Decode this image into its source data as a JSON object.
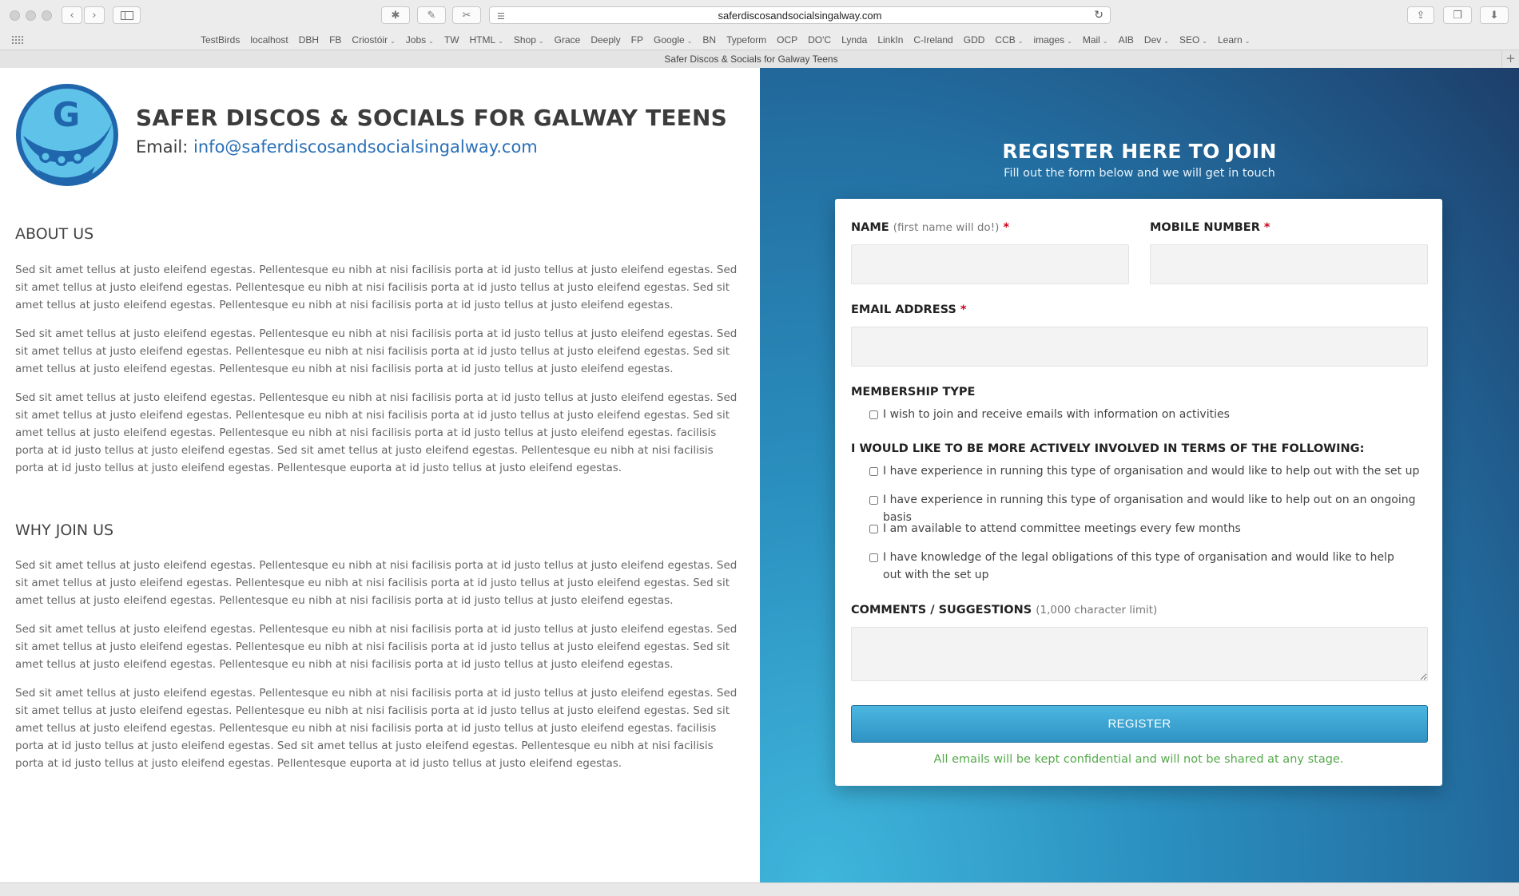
{
  "browser": {
    "url": "saferdiscosandsocialsingalway.com",
    "tab_title": "Safer Discos & Socials for Galway Teens",
    "bookmarks": [
      {
        "label": "TestBirds",
        "menu": false
      },
      {
        "label": "localhost",
        "menu": false
      },
      {
        "label": "DBH",
        "menu": false
      },
      {
        "label": "FB",
        "menu": false
      },
      {
        "label": "Criostóir",
        "menu": true
      },
      {
        "label": "Jobs",
        "menu": true
      },
      {
        "label": "TW",
        "menu": false
      },
      {
        "label": "HTML",
        "menu": true
      },
      {
        "label": "Shop",
        "menu": true
      },
      {
        "label": "Grace",
        "menu": false
      },
      {
        "label": "Deeply",
        "menu": false
      },
      {
        "label": "FP",
        "menu": false
      },
      {
        "label": "Google",
        "menu": true
      },
      {
        "label": "BN",
        "menu": false
      },
      {
        "label": "Typeform",
        "menu": false
      },
      {
        "label": "OCP",
        "menu": false
      },
      {
        "label": "DO'C",
        "menu": false
      },
      {
        "label": "Lynda",
        "menu": false
      },
      {
        "label": "LinkIn",
        "menu": false
      },
      {
        "label": "C-Ireland",
        "menu": false
      },
      {
        "label": "GDD",
        "menu": false
      },
      {
        "label": "CCB",
        "menu": true
      },
      {
        "label": "images",
        "menu": true
      },
      {
        "label": "Mail",
        "menu": true
      },
      {
        "label": "AIB",
        "menu": false
      },
      {
        "label": "Dev",
        "menu": true
      },
      {
        "label": "SEO",
        "menu": true
      },
      {
        "label": "Learn",
        "menu": true
      }
    ]
  },
  "header": {
    "logo_letter": "G",
    "title": "SAFER DISCOS & SOCIALS FOR GALWAY TEENS",
    "email_label": "Email:",
    "email": "info@saferdiscosandsocialsingalway.com"
  },
  "about": {
    "heading": "ABOUT US",
    "paragraphs": [
      "Sed sit amet tellus at justo eleifend egestas. Pellentesque eu nibh at nisi facilisis porta at id justo tellus at justo eleifend egestas. Sed sit amet tellus at justo eleifend egestas. Pellentesque eu nibh at nisi facilisis porta at id justo tellus at justo eleifend egestas. Sed sit amet tellus at justo eleifend egestas. Pellentesque eu nibh at nisi facilisis porta at id justo tellus at justo eleifend egestas.",
      "Sed sit amet tellus at justo eleifend egestas. Pellentesque eu nibh at nisi facilisis porta at id justo tellus at justo eleifend egestas. Sed sit amet tellus at justo eleifend egestas. Pellentesque eu nibh at nisi facilisis porta at id justo tellus at justo eleifend egestas. Sed sit amet tellus at justo eleifend egestas. Pellentesque eu nibh at nisi facilisis porta at id justo tellus at justo eleifend egestas.",
      "Sed sit amet tellus at justo eleifend egestas. Pellentesque eu nibh at nisi facilisis porta at id justo tellus at justo eleifend egestas. Sed sit amet tellus at justo eleifend egestas. Pellentesque eu nibh at nisi facilisis porta at id justo tellus at justo eleifend egestas. Sed sit amet tellus at justo eleifend egestas. Pellentesque eu nibh at nisi facilisis porta at id justo tellus at justo eleifend egestas. facilisis porta at id justo tellus at justo eleifend egestas. Sed sit amet tellus at justo eleifend egestas. Pellentesque eu nibh at nisi facilisis porta at id justo tellus at justo eleifend egestas. Pellentesque euporta at id justo tellus at justo eleifend egestas."
    ]
  },
  "why": {
    "heading": "WHY JOIN US",
    "paragraphs": [
      "Sed sit amet tellus at justo eleifend egestas. Pellentesque eu nibh at nisi facilisis porta at id justo tellus at justo eleifend egestas. Sed sit amet tellus at justo eleifend egestas. Pellentesque eu nibh at nisi facilisis porta at id justo tellus at justo eleifend egestas. Sed sit amet tellus at justo eleifend egestas. Pellentesque eu nibh at nisi facilisis porta at id justo tellus at justo eleifend egestas.",
      "Sed sit amet tellus at justo eleifend egestas. Pellentesque eu nibh at nisi facilisis porta at id justo tellus at justo eleifend egestas. Sed sit amet tellus at justo eleifend egestas. Pellentesque eu nibh at nisi facilisis porta at id justo tellus at justo eleifend egestas. Sed sit amet tellus at justo eleifend egestas. Pellentesque eu nibh at nisi facilisis porta at id justo tellus at justo eleifend egestas.",
      "Sed sit amet tellus at justo eleifend egestas. Pellentesque eu nibh at nisi facilisis porta at id justo tellus at justo eleifend egestas. Sed sit amet tellus at justo eleifend egestas. Pellentesque eu nibh at nisi facilisis porta at id justo tellus at justo eleifend egestas. Sed sit amet tellus at justo eleifend egestas. Pellentesque eu nibh at nisi facilisis porta at id justo tellus at justo eleifend egestas. facilisis porta at id justo tellus at justo eleifend egestas. Sed sit amet tellus at justo eleifend egestas. Pellentesque eu nibh at nisi facilisis porta at id justo tellus at justo eleifend egestas. Pellentesque euporta at id justo tellus at justo eleifend egestas."
    ]
  },
  "register": {
    "title": "REGISTER HERE TO JOIN",
    "subtitle": "Fill out the form below and we will get in touch",
    "name_label": "NAME",
    "name_hint": "(first name will do!)",
    "mobile_label": "MOBILE NUMBER",
    "email_label": "EMAIL ADDRESS",
    "required_mark": "*",
    "name_value": "",
    "mobile_value": "",
    "email_value": "",
    "membership_heading": "MEMBERSHIP TYPE",
    "membership_option": "I wish to join and receive emails with information on activities",
    "involved_heading": "I WOULD LIKE TO BE MORE ACTIVELY INVOLVED IN TERMS OF THE FOLLOWING:",
    "involved_options": [
      "I have experience in running this type of organisation and would like to help out with the set up",
      "I have experience in running this type of organisation and would like to help out on an ongoing basis",
      "I am available to attend committee meetings every few months",
      "I have knowledge of the legal obligations of this type of organisation and would like to help out with the set up"
    ],
    "comments_label": "COMMENTS / SUGGESTIONS",
    "comments_hint": "(1,000 character limit)",
    "comments_value": "",
    "button_label": "REGISTER",
    "confidential_note": "All emails will be kept confidential and will not be shared at any stage."
  },
  "colors": {
    "accent_blue": "#2a6fb6",
    "panel_gradient_light": "#3fb6dc",
    "panel_gradient_dark": "#1d3e6a",
    "required_red": "#d0021b",
    "note_green": "#55a94b",
    "button_blue": "#3ba4d2"
  }
}
